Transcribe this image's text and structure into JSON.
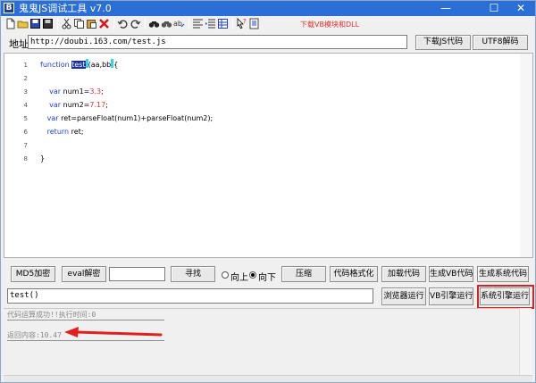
{
  "window": {
    "title": "鬼鬼JS调试工具 v7.0",
    "app_icon_letter": "B",
    "minimize": "—",
    "maximize": "☐",
    "close": "✕"
  },
  "toolbar": {
    "note": "下载VB模块和DLL",
    "icons": [
      "new-file-icon",
      "open-folder-icon",
      "save-icon",
      "save-as-icon",
      "cut-icon",
      "copy-icon",
      "paste-icon",
      "delete-icon",
      "undo-icon",
      "redo-icon",
      "find-icon",
      "find-next-icon",
      "replace-icon",
      "format-icon",
      "indent-icon",
      "outdent-icon",
      "grid-icon",
      "help-pointer-icon",
      "about-icon"
    ]
  },
  "address": {
    "label": "地址:",
    "value": "http://doubi.163.com/test.js",
    "download_js_button": "下载JS代码",
    "utf8_decode_button": "UTF8解码"
  },
  "editor": {
    "lines": [
      {
        "n": "1",
        "parts": [
          [
            "kw",
            "function "
          ],
          [
            "sel",
            "test"
          ],
          [
            "caret",
            ""
          ],
          [
            "",
            "(aa,bb"
          ],
          [
            "caret",
            ""
          ],
          [
            "",
            "{"
          ]
        ]
      },
      {
        "n": "2",
        "parts": []
      },
      {
        "n": "3",
        "parts": [
          [
            "",
            "    "
          ],
          [
            "kw",
            "var "
          ],
          [
            "",
            "num1="
          ],
          [
            "num",
            "3.3"
          ],
          [
            "",
            ";"
          ]
        ]
      },
      {
        "n": "4",
        "parts": [
          [
            "",
            "    "
          ],
          [
            "kw",
            "var "
          ],
          [
            "",
            "num2="
          ],
          [
            "num",
            "7.17"
          ],
          [
            "",
            ";"
          ]
        ]
      },
      {
        "n": "5",
        "parts": [
          [
            "",
            "   "
          ],
          [
            "kw",
            "var "
          ],
          [
            "",
            "ret=parseFloat(num1)+parseFloat(num2);"
          ]
        ]
      },
      {
        "n": "6",
        "parts": [
          [
            "",
            "   "
          ],
          [
            "kw",
            "return "
          ],
          [
            "",
            "ret;"
          ]
        ]
      },
      {
        "n": "7",
        "parts": []
      },
      {
        "n": "8",
        "parts": [
          [
            "",
            "}"
          ]
        ]
      }
    ]
  },
  "controls": {
    "md5_button": "MD5加密",
    "eval_decode_button": "eval解密",
    "search_value": "",
    "find_button": "寻找",
    "radio_up_label": "向上",
    "radio_down_label": "向下",
    "radio_selected": "down",
    "compress_button": "压缩",
    "format_button": "代码格式化",
    "load_code_button": "加载代码",
    "gen_vb_button": "生成VB代码",
    "gen_sys_button": "生成系统代码",
    "command_value": "test()",
    "browser_run_button": "浏览器运行",
    "vb_engine_button": "VB引擎运行",
    "sys_engine_button": "系统引擎运行"
  },
  "output": {
    "line1": "代码运算成功!!执行时间:0",
    "line2": "返回内容:10.47"
  },
  "colors": {
    "accent": "#2b6fd6",
    "annotation_red": "#e02020"
  }
}
